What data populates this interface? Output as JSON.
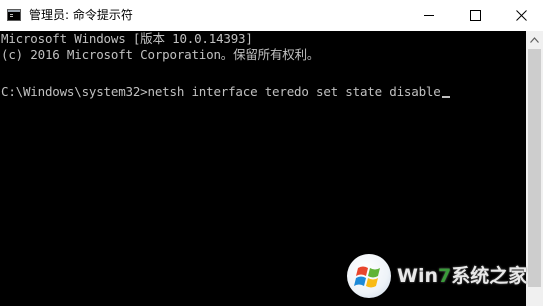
{
  "window": {
    "title": "管理员: 命令提示符"
  },
  "controls": {
    "minimize": "minimize",
    "maximize": "maximize",
    "close": "close"
  },
  "console": {
    "line1": "Microsoft Windows [版本 10.0.14393]",
    "line2": "(c) 2016 Microsoft Corporation。保留所有权利。",
    "prompt": "C:\\Windows\\system32>",
    "command": "netsh interface teredo set state disable"
  },
  "watermark": {
    "text_prefix": "Win",
    "text_seven": "7",
    "text_suffix": "系统之家"
  },
  "colors": {
    "console_bg": "#000000",
    "console_fg": "#c0c0c0",
    "titlebar_bg": "#ffffff",
    "watermark_accent": "#3a9a3a"
  },
  "icons": {
    "app": "cmd-icon",
    "minimize": "minimize-icon",
    "maximize": "maximize-icon",
    "close": "close-icon",
    "scroll_up": "chevron-up-icon",
    "watermark_logo": "windows-logo-icon"
  }
}
